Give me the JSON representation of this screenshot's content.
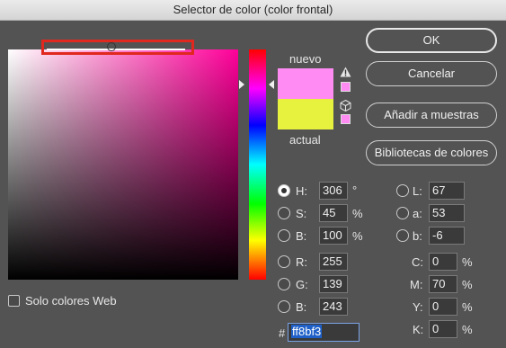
{
  "window": {
    "title": "Selector de color (color frontal)"
  },
  "swatches": {
    "new_label": "nuevo",
    "current_label": "actual",
    "new_color": "#ff8bf3",
    "current_color": "#e6f23e"
  },
  "buttons": {
    "ok": "OK",
    "cancel": "Cancelar",
    "add_swatches": "Añadir a muestras",
    "libraries": "Bibliotecas de colores"
  },
  "web_only": {
    "label": "Solo colores Web",
    "checked": false
  },
  "hsb": {
    "h_label": "H:",
    "h_value": "306",
    "h_unit": "°",
    "s_label": "S:",
    "s_value": "45",
    "s_unit": "%",
    "b_label": "B:",
    "b_value": "100",
    "b_unit": "%"
  },
  "rgb": {
    "r_label": "R:",
    "r_value": "255",
    "g_label": "G:",
    "g_value": "139",
    "b_label": "B:",
    "b_value": "243"
  },
  "lab": {
    "l_label": "L:",
    "l_value": "67",
    "a_label": "a:",
    "a_value": "53",
    "b_label": "b:",
    "b_value": "-6"
  },
  "cmyk": {
    "c_label": "C:",
    "c_value": "0",
    "m_label": "M:",
    "m_value": "70",
    "y_label": "Y:",
    "y_value": "0",
    "k_label": "K:",
    "k_value": "0",
    "unit": "%"
  },
  "hex": {
    "label": "#",
    "value": "ff8bf3"
  },
  "icons": {
    "gamut_warning": "warning-triangle-icon",
    "web_safe": "cube-icon"
  },
  "highlight_color": "#e0281f"
}
